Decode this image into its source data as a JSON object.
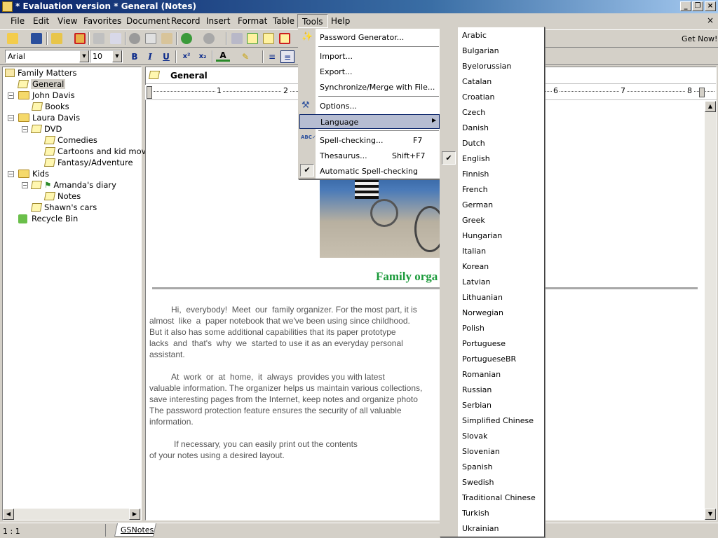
{
  "window": {
    "title": "* Evaluation version * General (Notes)"
  },
  "menubar": [
    "File",
    "Edit",
    "View",
    "Favorites",
    "Document",
    "Record",
    "Insert",
    "Format",
    "Table",
    "Tools",
    "Help"
  ],
  "toolbar": {
    "get_now": "Get Now!",
    "font": "Arial",
    "size": "10"
  },
  "tree": {
    "items": [
      {
        "label": "Family Matters"
      },
      {
        "label": "General"
      },
      {
        "label": "John Davis"
      },
      {
        "label": "Books"
      },
      {
        "label": "Laura Davis"
      },
      {
        "label": "DVD"
      },
      {
        "label": "Comedies"
      },
      {
        "label": "Cartoons and kid movies"
      },
      {
        "label": "Fantasy/Adventure"
      },
      {
        "label": "Kids"
      },
      {
        "label": "Amanda's diary"
      },
      {
        "label": "Notes"
      },
      {
        "label": "Shawn's cars"
      },
      {
        "label": "Recycle Bin"
      }
    ]
  },
  "editor": {
    "note_title": "General",
    "heading": "Family orga",
    "para1": [
      "Hi,  everybody!  Meet  our  family organizer. For the most part, it is",
      "almost  like  a  paper notebook that we've been using since childhood.",
      "But it also has some additional capabilities that its paper prototype",
      "lacks  and  that's  why  we  started to use it as an everyday personal",
      "assistant."
    ],
    "para2": [
      "At  work  or  at  home,  it  always  provides you with latest",
      "valuable information. The organizer helps us maintain various collections,",
      "save interesting pages from the Internet, keep notes and organize photo",
      "The password protection feature ensures the security of all valuable",
      "information."
    ],
    "para3": [
      "If necessary, you can easily print out the contents",
      "of your notes using a desired layout."
    ],
    "ruler_marks": [
      "1",
      "2",
      "6",
      "7",
      "8"
    ]
  },
  "tools_menu": {
    "items": [
      {
        "label": "Password Generator...",
        "shortcut": ""
      },
      {
        "label": "Import...",
        "shortcut": ""
      },
      {
        "label": "Export...",
        "shortcut": ""
      },
      {
        "label": "Synchronize/Merge with File...",
        "shortcut": ""
      },
      {
        "label": "Options...",
        "shortcut": ""
      },
      {
        "label": "Language",
        "shortcut": ""
      },
      {
        "label": "Spell-checking...",
        "shortcut": "F7"
      },
      {
        "label": "Thesaurus...",
        "shortcut": "Shift+F7"
      },
      {
        "label": "Automatic Spell-checking",
        "shortcut": ""
      }
    ]
  },
  "language_menu": {
    "items": [
      "Arabic",
      "Bulgarian",
      "Byelorussian",
      "Catalan",
      "Croatian",
      "Czech",
      "Danish",
      "Dutch",
      "English",
      "Finnish",
      "French",
      "German",
      "Greek",
      "Hungarian",
      "Italian",
      "Korean",
      "Latvian",
      "Lithuanian",
      "Norwegian",
      "Polish",
      "Portuguese",
      "PortugueseBR",
      "Romanian",
      "Russian",
      "Serbian",
      "Simplified Chinese",
      "Slovak",
      "Slovenian",
      "Spanish",
      "Swedish",
      "Traditional Chinese",
      "Turkish",
      "Ukrainian"
    ],
    "checked": "English"
  },
  "status": {
    "position": "1 : 1",
    "tab": "GSNotes"
  },
  "colors": {
    "accent": "#0a246a",
    "heading": "#1a9a3a",
    "highlight": "#b6bdd2"
  }
}
